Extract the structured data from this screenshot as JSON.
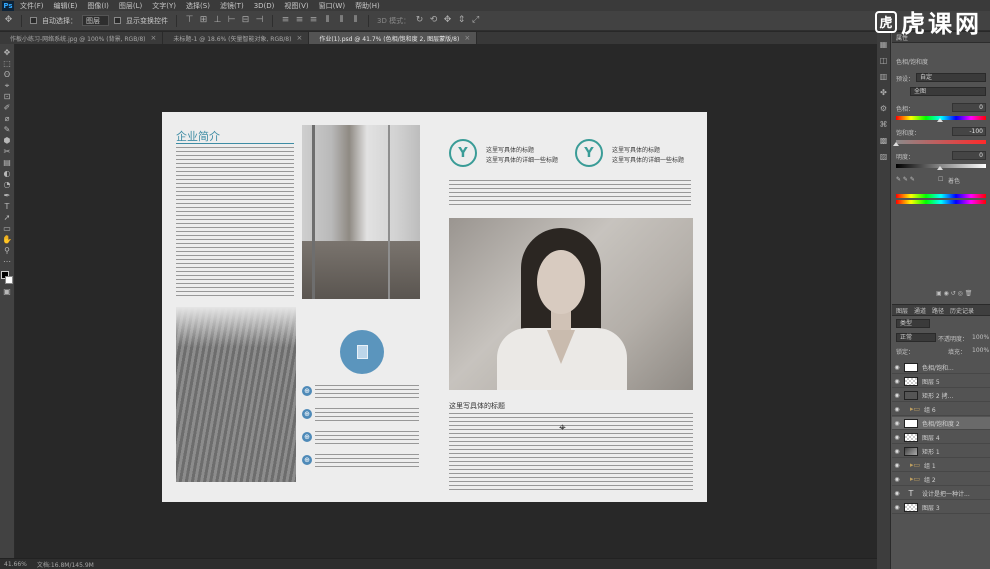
{
  "app": {
    "logo": "Ps",
    "menus": [
      "文件(F)",
      "编辑(E)",
      "图像(I)",
      "图层(L)",
      "文字(Y)",
      "选择(S)",
      "滤镜(T)",
      "3D(D)",
      "视图(V)",
      "窗口(W)",
      "帮助(H)"
    ]
  },
  "options": {
    "auto_select_label": "自动选择：",
    "auto_select_target": "图层",
    "show_transform_label": "显示变换控件",
    "mode_3d_label": "3D 模式："
  },
  "watermark": {
    "mark": "虎",
    "text": "虎课网"
  },
  "tabs": [
    {
      "label": "作板小练习-网络系统.jpg @ 100% (背景, RGB/8)",
      "active": false
    },
    {
      "label": "未标题-1 @ 18.6% (矢量智能对象, RGB/8)",
      "active": false
    },
    {
      "label": "作业(1).psd @ 41.7% (色相/饱和度 2, 图层蒙版/8)",
      "active": true
    }
  ],
  "tab_close": "×",
  "tools": [
    "✥",
    "⬚",
    "ʘ",
    "⌖",
    "⊡",
    "✐",
    "⌀",
    "✎",
    "⬢",
    "✂",
    "▤",
    "◐",
    "◔",
    "✒",
    "T",
    "➚",
    "▭",
    "✋",
    "⚲",
    "⋯",
    "▣"
  ],
  "document": {
    "title": "企业简介",
    "badge_glyph": "Y",
    "badge1_title": "这里写具体的标题",
    "badge1_subtitle": "这里写具体的详细一些标题",
    "badge2_title": "这里写具体的标题",
    "badge2_subtitle": "这里写具体的详细一些标题",
    "right_heading": "这里写具体的标题",
    "globe_glyph": "⊕",
    "cursor": "⌖"
  },
  "status": {
    "zoom": "41.66%",
    "doc_size": "文档:16.8M/145.9M"
  },
  "panel_icons": [
    "▦",
    "◫",
    "▥",
    "✤",
    "⚙",
    "⌘",
    "▩",
    "▨"
  ],
  "properties": {
    "header": "属性",
    "adjustment_name": "色相/饱和度",
    "preset_label": "预设：",
    "preset_value": "自定",
    "channel_value": "全图",
    "hue_label": "色相：",
    "hue_value": "0",
    "saturation_label": "饱和度：",
    "saturation_value": "-100",
    "lightness_label": "明度：",
    "lightness_value": "0",
    "colorize_label": "着色",
    "slider_colors": {
      "hue": "#ff0000",
      "sat_low": "#8a8a8a",
      "sat_high": "#ff2a2a"
    }
  },
  "layers": {
    "tabs": [
      "图层",
      "通道",
      "路径",
      "历史记录"
    ],
    "filter_label": "类型",
    "blend_mode": "正常",
    "opacity_label": "不透明度：",
    "opacity_value": "100%",
    "lock_label": "锁定：",
    "fill_label": "填充：",
    "fill_value": "100%",
    "items": [
      {
        "name": "色相/饱和...",
        "thumb": "white",
        "kind": "adjust",
        "selected": false
      },
      {
        "name": "图层 5",
        "thumb": "checker",
        "kind": "layer",
        "selected": false
      },
      {
        "name": "矩形 2 拷...",
        "thumb": "dark",
        "kind": "layer",
        "selected": false
      },
      {
        "name": "组 6",
        "thumb": "",
        "kind": "group",
        "selected": false
      },
      {
        "name": "色相/饱和度 2",
        "thumb": "white",
        "kind": "adjust",
        "selected": true
      },
      {
        "name": "图层 4",
        "thumb": "checker",
        "kind": "layer",
        "selected": false
      },
      {
        "name": "矩形 1",
        "thumb": "photo",
        "kind": "layer",
        "selected": false
      },
      {
        "name": "组 1",
        "thumb": "",
        "kind": "group",
        "selected": false
      },
      {
        "name": "组 2",
        "thumb": "",
        "kind": "group",
        "selected": false
      },
      {
        "name": "设计是把一种计...",
        "thumb": "",
        "kind": "text",
        "selected": false
      },
      {
        "name": "图层 3",
        "thumb": "checker",
        "kind": "layer",
        "selected": false
      }
    ]
  }
}
